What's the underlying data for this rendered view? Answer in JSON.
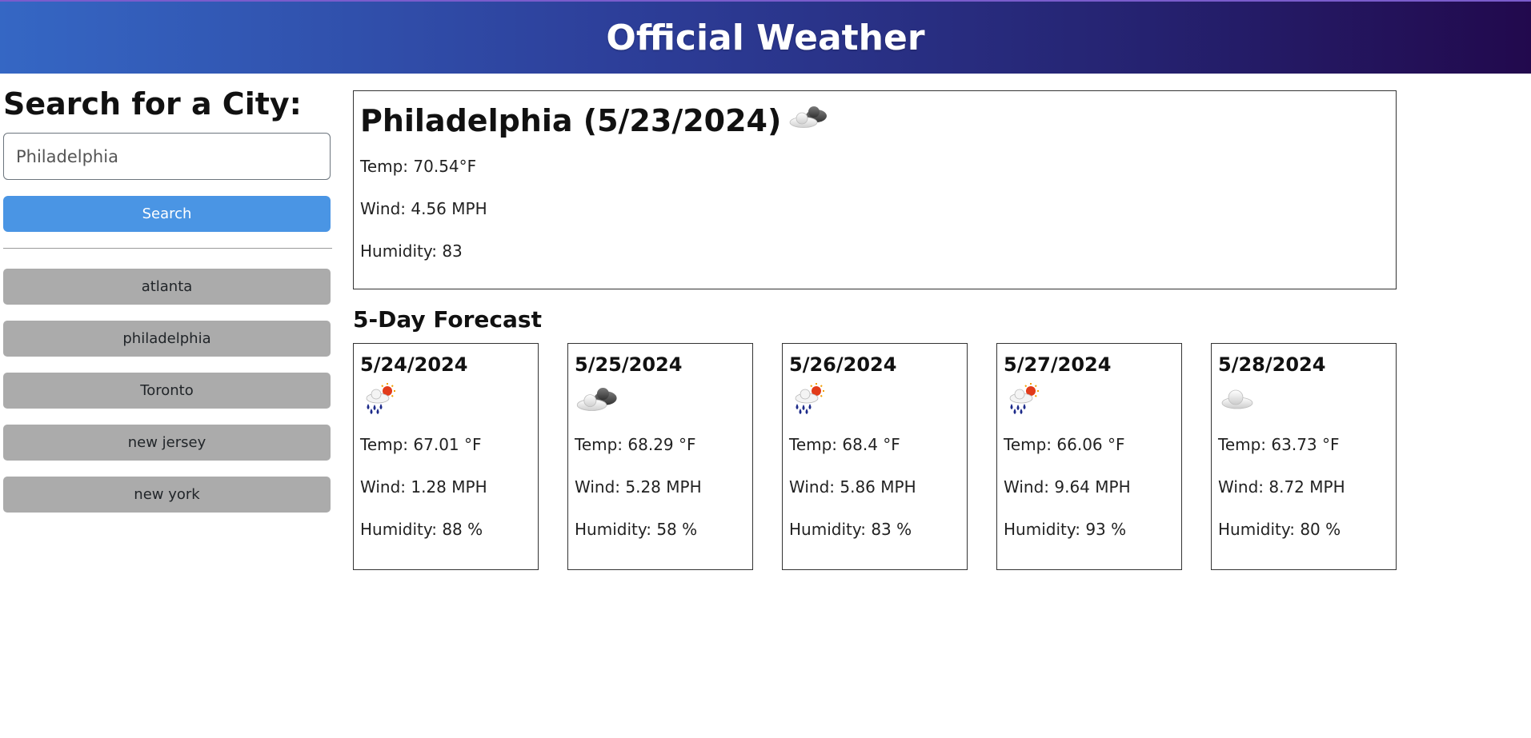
{
  "header": {
    "title": "Official Weather"
  },
  "sidebar": {
    "heading": "Search for a City:",
    "search": {
      "value": "Philadelphia",
      "placeholder": ""
    },
    "search_button_label": "Search",
    "history": [
      "atlanta",
      "philadelphia",
      "Toronto",
      "new jersey",
      "new york"
    ]
  },
  "current": {
    "title": "Philadelphia (5/23/2024)",
    "icon": "broken-clouds-icon",
    "temp": "Temp: 70.54°F",
    "wind": "Wind: 4.56 MPH",
    "humidity": "Humidity: 83"
  },
  "forecast": {
    "title": "5-Day Forecast",
    "days": [
      {
        "date": "5/24/2024",
        "icon": "rain-sun-icon",
        "temp": "Temp: 67.01 °F",
        "wind": "Wind: 1.28 MPH",
        "humidity": "Humidity: 88 %"
      },
      {
        "date": "5/25/2024",
        "icon": "broken-clouds-icon",
        "temp": "Temp: 68.29 °F",
        "wind": "Wind: 5.28 MPH",
        "humidity": "Humidity: 58 %"
      },
      {
        "date": "5/26/2024",
        "icon": "rain-sun-icon",
        "temp": "Temp: 68.4 °F",
        "wind": "Wind: 5.86 MPH",
        "humidity": "Humidity: 83 %"
      },
      {
        "date": "5/27/2024",
        "icon": "rain-sun-icon",
        "temp": "Temp: 66.06 °F",
        "wind": "Wind: 9.64 MPH",
        "humidity": "Humidity: 93 %"
      },
      {
        "date": "5/28/2024",
        "icon": "cloud-icon",
        "temp": "Temp: 63.73 °F",
        "wind": "Wind: 8.72 MPH",
        "humidity": "Humidity: 80 %"
      }
    ]
  },
  "colors": {
    "header_gradient_start": "#3567c4",
    "header_gradient_end": "#22094d",
    "search_button": "#4a95e4",
    "history_button": "#ababab"
  }
}
